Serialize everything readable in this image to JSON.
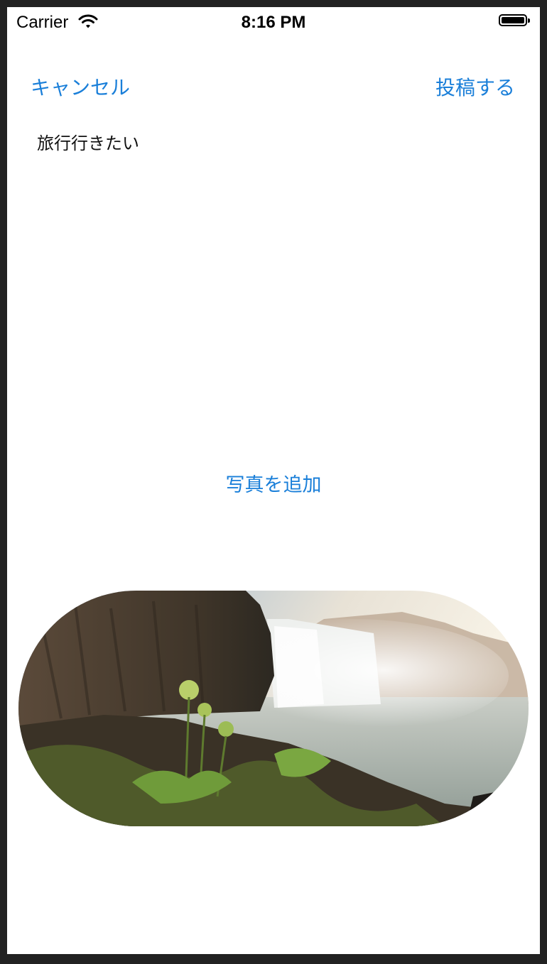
{
  "status_bar": {
    "carrier": "Carrier",
    "time": "8:16 PM"
  },
  "nav": {
    "cancel_label": "キャンセル",
    "post_label": "投稿する"
  },
  "post": {
    "text": "旅行行きたい"
  },
  "add_photo_label": "写真を追加",
  "colors": {
    "accent": "#1a7fd9",
    "background": "#ffffff",
    "frame": "#222222"
  }
}
